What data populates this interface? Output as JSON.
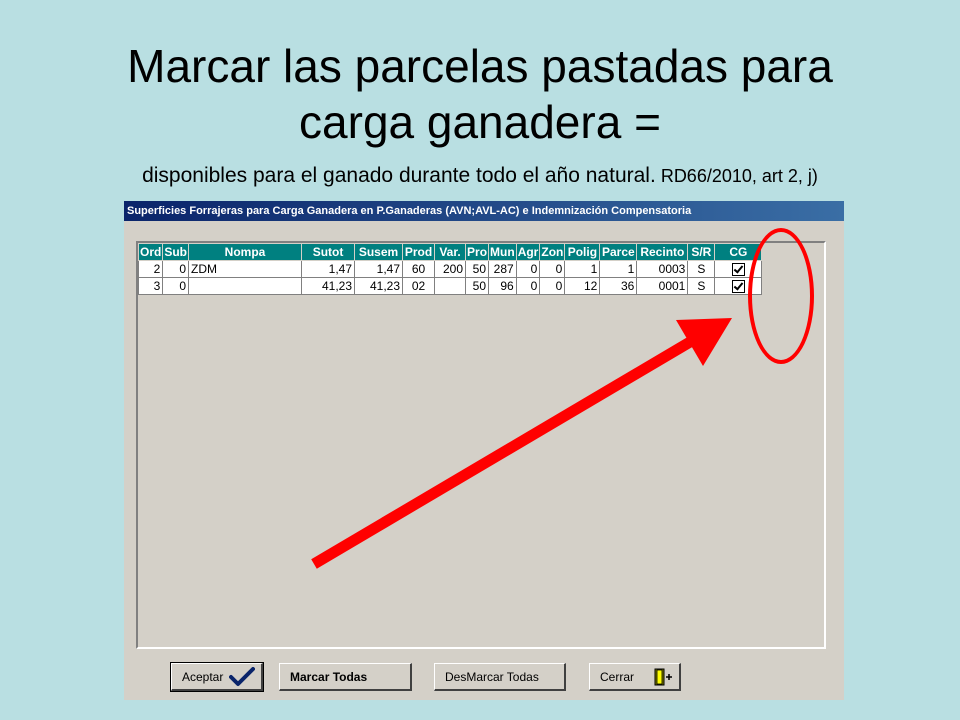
{
  "slide": {
    "title_line1": "Marcar las parcelas pastadas para",
    "title_line2": "carga ganadera =",
    "subtitle_main": "disponibles para el ganado durante todo el año natural.",
    "subtitle_ref": " RD66/2010,  art 2, j)"
  },
  "window": {
    "title": "Superficies Forrajeras para Carga Ganadera en P.Ganaderas (AVN;AVL-AC) e Indemnización Compensatoria"
  },
  "grid": {
    "headers": [
      "Ord",
      "Sub",
      "Nompa",
      "Sutot",
      "Susem",
      "Prod",
      "Var.",
      "Pro",
      "Mun",
      "Agr",
      "Zon",
      "Polig",
      "Parce",
      "Recinto",
      "S/R",
      "CG"
    ],
    "rows": [
      [
        "2",
        "0",
        "ZDM",
        "1,47",
        "1,47",
        "60",
        "200",
        "50",
        "287",
        "0",
        "0",
        "1",
        "1",
        "0003",
        "S"
      ],
      [
        "3",
        "0",
        "",
        "41,23",
        "41,23",
        "02",
        "",
        "50",
        "96",
        "0",
        "0",
        "12",
        "36",
        "0001",
        "S"
      ]
    ],
    "cg_checked": [
      true,
      true
    ]
  },
  "buttons": {
    "aceptar": "Aceptar",
    "marcar_todas": "Marcar Todas",
    "desmarcar_todas": "DesMarcar Todas",
    "cerrar": "Cerrar"
  },
  "colors": {
    "annotation": "#ff0000",
    "header_bg": "#008080",
    "titlebar": "#0a246a"
  }
}
